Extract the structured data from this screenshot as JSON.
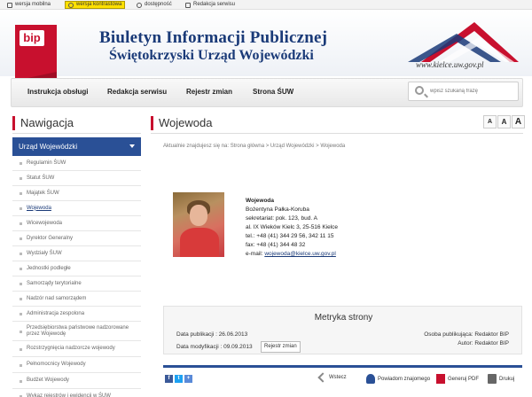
{
  "topbar": {
    "mobile": "wersja mobilna",
    "contrast": "wersja kontrastowa",
    "accessibility": "dostępność",
    "editorial": "Redakcja serwisu"
  },
  "header": {
    "logo_text": "bip",
    "title": "Biuletyn Informacji Publicznej",
    "subtitle": "Świętokrzyski Urząd Wojewódzki",
    "url": "www.kielce.uw.gov.pl"
  },
  "nav": {
    "items": [
      "Instrukcja obsługi",
      "Redakcja serwisu",
      "Rejestr zmian",
      "Strona ŚUW"
    ],
    "search_placeholder": "wpisz szukaną frazę"
  },
  "sidebar": {
    "heading": "Nawigacja",
    "active": "Urząd Wojewódzki",
    "items": [
      "Regulamin ŚUW",
      "Statut ŚUW",
      "Majątek ŚUW",
      "Wojewoda",
      "Wicewojewoda",
      "Dyrektor Generalny",
      "Wydziały ŚUW",
      "Jednostki podległe",
      "Samorządy terytorialne",
      "Nadzór nad samorządem",
      "Administracja zespolona",
      "Przedsiębiorstwa państwowe nadzorowane przez Wojewodę",
      "Rozstrzygnięcia nadzorcze wojewody",
      "Pełnomocnicy Wojewody",
      "Budżet Wojewody",
      "Wykaz rejestrów i ewidencji w ŚUW"
    ],
    "current_index": 3
  },
  "main": {
    "heading": "Wojewoda",
    "font_sizes": [
      "A",
      "A",
      "A"
    ],
    "breadcrumb": "Aktualnie znajdujesz się na:   Strona główna  >  Urząd Wojewódzki  >  Wojewoda",
    "info": {
      "title": "Wojewoda",
      "name": "Bożentyna Pałka-Koruba",
      "office": "sekretariat: pok. 123, bud. A",
      "address": "al. IX Wieków Kielc 3, 25-516 Kielce",
      "phone": "tel.: +48 (41) 344 29 56, 342 11 15",
      "fax": "fax: +48 (41) 344 48 32",
      "email_label": "e-mail: ",
      "email": "wojewoda@kielce.uw.gov.pl"
    },
    "metryka": {
      "title": "Metryka strony",
      "published": "Data publikacji : 26.06.2013",
      "modified": "Data modyfikacji : 09.09.2013",
      "register_button": "Rejestr zmian",
      "publisher": "Osoba publikująca: Redaktor BIP",
      "author": "Autor: Redaktor BIP"
    },
    "footer_tools": {
      "back": "Wstecz",
      "notify": "Powiadom znajomego",
      "pdf": "Generuj PDF",
      "print": "Drukuj"
    }
  },
  "colors": {
    "brand_red": "#c8102e",
    "navy": "#1a3a78",
    "sidebar_active": "#2a5096",
    "contrast_yellow": "#ffe000"
  }
}
